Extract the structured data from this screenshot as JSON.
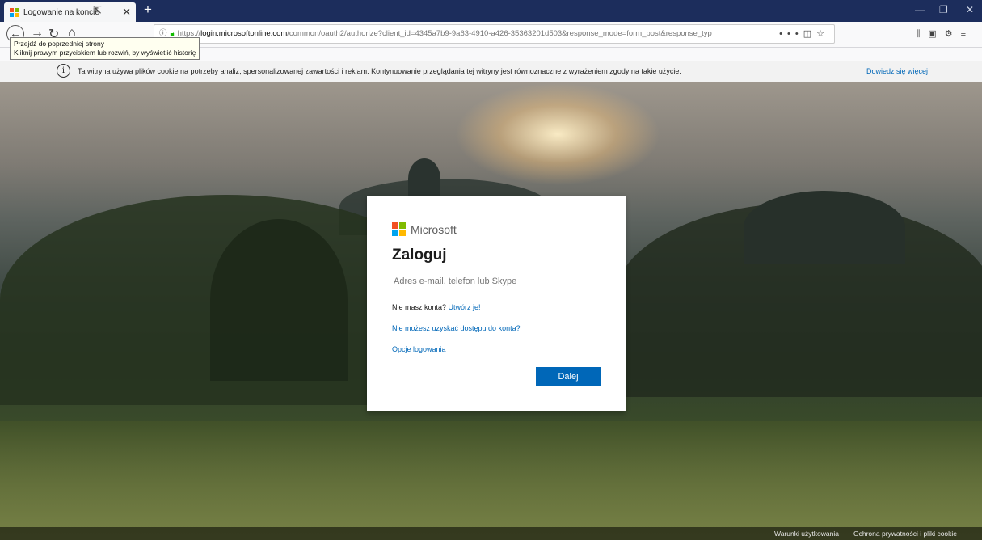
{
  "tab": {
    "title": "Logowanie na koncie"
  },
  "address_bar": {
    "url_prefix": "https://",
    "url_host": "login.microsoftonline.com",
    "url_rest": "/common/oauth2/authorize?client_id=4345a7b9-9a63-4910-a426-35363201d503&response_mode=form_post&response_typ"
  },
  "tooltip": {
    "line1": "Przejdź do poprzedniej strony",
    "line2": "Kliknij prawym przyciskiem lub rozwiń, by wyświetlić historię"
  },
  "cookie_notice": {
    "text": "Ta witryna używa plików cookie na potrzeby analiz, spersonalizowanej zawartości i reklam. Kontynuowanie przeglądania tej witryny jest równoznaczne z wyrażeniem zgody na takie użycie.",
    "learn_more": "Dowiedz się więcej"
  },
  "login": {
    "brand": "Microsoft",
    "heading": "Zaloguj",
    "email_placeholder": "Adres e-mail, telefon lub Skype",
    "no_account_text": "Nie masz konta?",
    "create_link": "Utwórz je!",
    "cant_access_link": "Nie możesz uzyskać dostępu do konta?",
    "signin_options_link": "Opcje logowania",
    "next_button": "Dalej"
  },
  "footer": {
    "terms": "Warunki użytkowania",
    "privacy": "Ochrona prywatności i pliki cookie",
    "more": "···"
  },
  "colors": {
    "accent": "#0067b8",
    "titlebar": "#1c2d5c",
    "ms_red": "#f25022",
    "ms_green": "#7fba00",
    "ms_blue": "#00a4ef",
    "ms_yellow": "#ffb900"
  }
}
